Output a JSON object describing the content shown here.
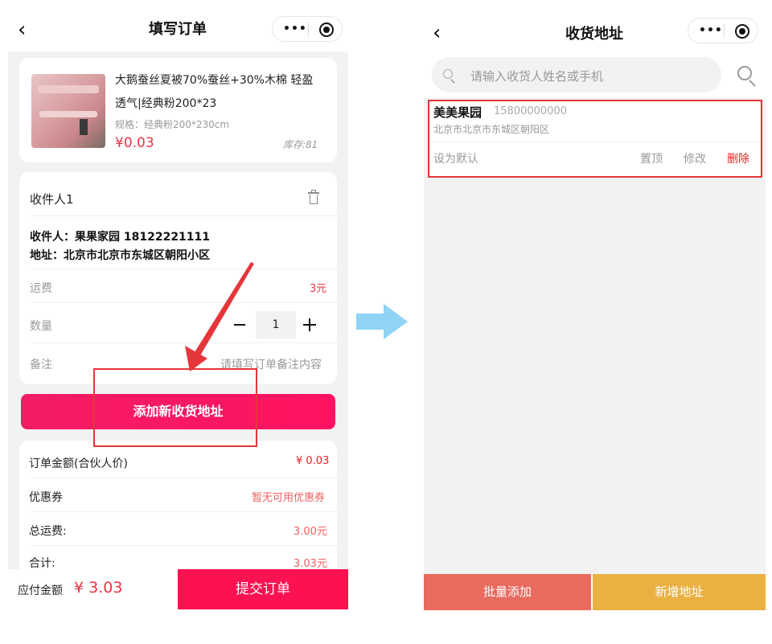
{
  "left": {
    "nav": {
      "back_icon": "chevron-left-icon",
      "title": "填写订单",
      "more_icon": "more-dots-icon",
      "close_icon": "target-circle-icon"
    },
    "product": {
      "image_icon": "product-thumbnail-pink-quilt",
      "name_line1": "大鹅蚕丝夏被70%蚕丝+30%木棉 轻盈",
      "name_line2": "透气|经典粉200*23",
      "spec": "规格：经典粉200*230cm",
      "price": "¥0.03",
      "stock": "库存:81"
    },
    "receiver": {
      "header": "收件人1",
      "trash_icon": "trash-icon",
      "name_line": "收件人：果果家园 18122221111",
      "address_line": "地址：北京市北京市东城区朝阳小区",
      "shipping_label": "运费",
      "shipping_value": "3元",
      "qty_label": "数量",
      "qty_value": "1",
      "remark_label": "备注",
      "remark_placeholder": "请填写订单备注内容"
    },
    "add_address_button": "添加新收货地址",
    "summary": [
      {
        "label": "订单金额(合伙人价)",
        "value": "¥ 0.03"
      },
      {
        "label": "优惠券",
        "value": "暂无可用优惠券"
      },
      {
        "label": "总运费:",
        "value": "3.00元"
      },
      {
        "label": "合计:",
        "value": "3.03元"
      }
    ],
    "footer": {
      "payable_label": "应付金额",
      "payable_amount": "¥ 3.03",
      "submit_button": "提交订单"
    }
  },
  "right": {
    "nav": {
      "back_icon": "chevron-left-icon",
      "title": "收货地址",
      "more_icon": "more-dots-icon",
      "close_icon": "target-circle-icon"
    },
    "search": {
      "placeholder": "请输入收货人姓名或手机",
      "icon": "search-icon"
    },
    "address": {
      "name": "美美果园",
      "phone": "15800000000",
      "detail": "北京市北京市东城区朝阳区",
      "set_default": "设为默认",
      "pin_top": "置顶",
      "edit": "修改",
      "delete": "删除"
    },
    "batch_add_button": "批量添加",
    "new_address_button": "新增地址"
  },
  "colors": {
    "accent_pink": "#fc1151",
    "price_red": "#ee3344",
    "batch_button": "#e96a5f",
    "new_button": "#eab142",
    "arrow": "#8fd3f5",
    "highlight": "#e5363b"
  }
}
